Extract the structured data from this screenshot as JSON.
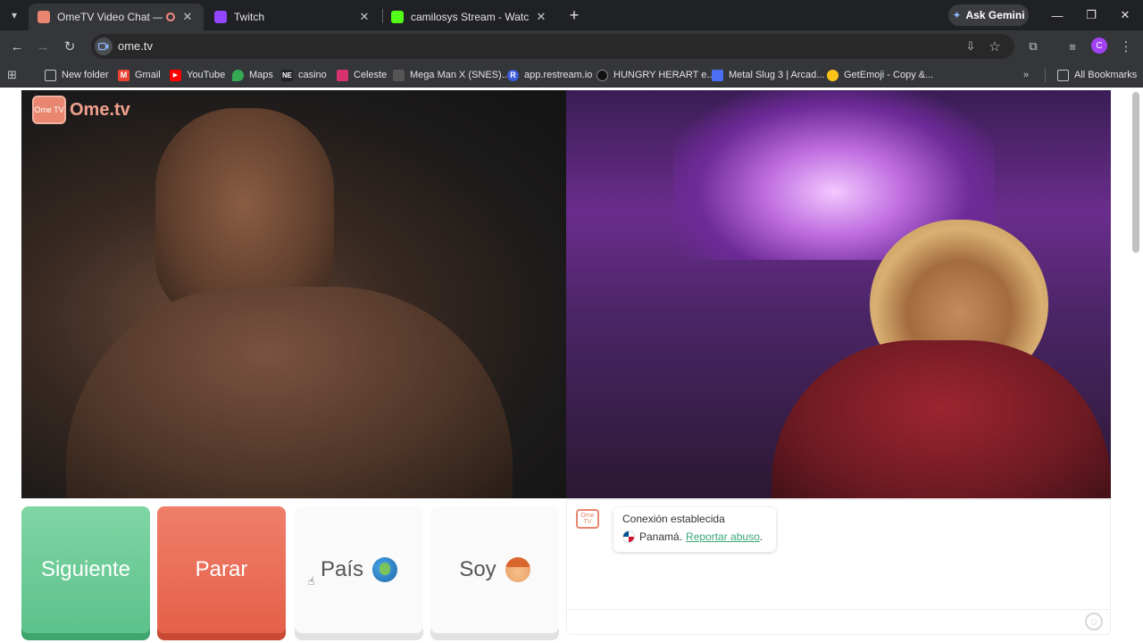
{
  "browser": {
    "tabs": [
      {
        "title": "OmeTV Video Chat — Ome",
        "active": true,
        "favicon_color": "#e8866f"
      },
      {
        "title": "Twitch",
        "active": false,
        "favicon_color": "#9146ff"
      },
      {
        "title": "camilosys Stream - Watch Live",
        "active": false,
        "favicon_color": "#53fc18"
      }
    ],
    "gemini_label": "Ask Gemini",
    "url": "ome.tv",
    "profile_initial": "C",
    "bookmarks": [
      {
        "label": "New folder",
        "icon": "folder-icon"
      },
      {
        "label": "Gmail",
        "icon": "gmail-icon"
      },
      {
        "label": "YouTube",
        "icon": "youtube-icon"
      },
      {
        "label": "Maps",
        "icon": "maps-icon"
      },
      {
        "label": "casino",
        "icon": "ne-icon"
      },
      {
        "label": "Celeste",
        "icon": "celeste-icon"
      },
      {
        "label": "Mega Man X (SNES)...",
        "icon": "megaman-icon"
      },
      {
        "label": "app.restream.io",
        "icon": "restream-icon"
      },
      {
        "label": "HUNGRY HERART e...",
        "icon": "hungry-icon"
      },
      {
        "label": "Metal Slug 3 | Arcad...",
        "icon": "metalslug-icon"
      },
      {
        "label": "GetEmoji - Copy &...",
        "icon": "emoji-icon"
      }
    ],
    "all_bookmarks": "All Bookmarks"
  },
  "ometv": {
    "logo_tv": "Ome TV",
    "logo_text": "Ome.tv",
    "buttons": {
      "next": "Siguiente",
      "stop": "Parar",
      "country": "País",
      "gender": "Soy"
    },
    "chat": {
      "avatar_text": "Ome TV",
      "status": "Conexión establecida",
      "country": "Panamá.",
      "report": "Reportar abuso",
      "report_suffix": "."
    }
  }
}
